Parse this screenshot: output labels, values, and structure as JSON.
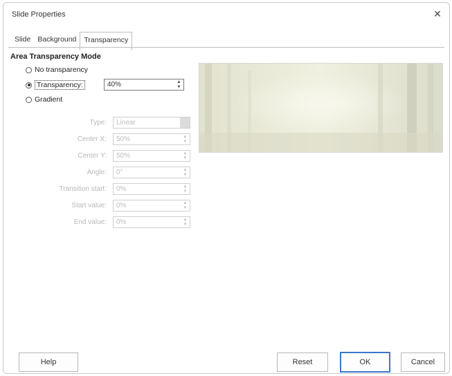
{
  "dialog": {
    "title": "Slide Properties",
    "close_glyph": "✕"
  },
  "tabs": [
    {
      "label": "Slide",
      "active": false
    },
    {
      "label": "Background",
      "active": false
    },
    {
      "label": "Transparency",
      "active": true
    }
  ],
  "section_title": "Area Transparency Mode",
  "modes": {
    "none": {
      "label": "No transparency",
      "selected": false
    },
    "transparency": {
      "label": "Transparency:",
      "selected": true,
      "value": "40%"
    },
    "gradient": {
      "label": "Gradient",
      "selected": false
    }
  },
  "gradient_fields": {
    "type": {
      "label": "Type:",
      "value": "Linear"
    },
    "center_x": {
      "label": "Center X:",
      "value": "50%"
    },
    "center_y": {
      "label": "Center Y:",
      "value": "50%"
    },
    "angle": {
      "label": "Angle:",
      "value": "0°"
    },
    "transition_start": {
      "label": "Transition start:",
      "value": "0%"
    },
    "start_value": {
      "label": "Start value:",
      "value": "0%"
    },
    "end_value": {
      "label": "End value:",
      "value": "0%"
    }
  },
  "buttons": {
    "help": "Help",
    "reset": "Reset",
    "ok": "OK",
    "cancel": "Cancel"
  }
}
